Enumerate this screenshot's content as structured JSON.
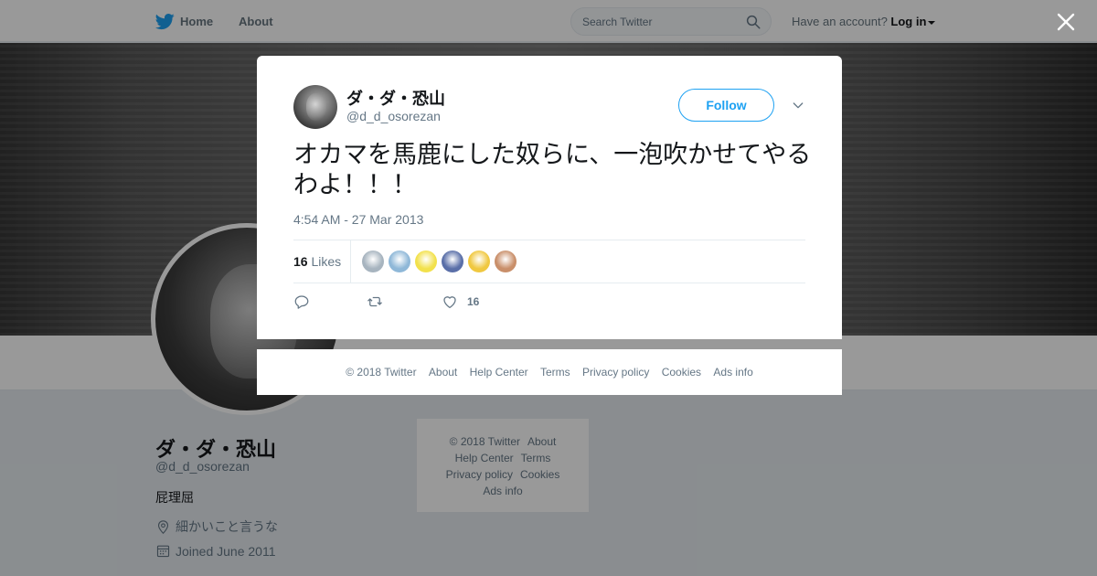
{
  "topbar": {
    "home_label": "Home",
    "about_label": "About",
    "search_placeholder": "Search Twitter",
    "account_prompt": "Have an account?",
    "login_label": "Log in"
  },
  "profile": {
    "name": "ダ・ダ・恐山",
    "handle": "@d_d_osorezan",
    "bio": "屁理屈",
    "location": "細かいこと言うな",
    "joined": "Joined June 2011"
  },
  "side_footer": {
    "links": [
      "© 2018 Twitter",
      "About",
      "Help Center",
      "Terms",
      "Privacy policy",
      "Cookies",
      "Ads info"
    ]
  },
  "tweet": {
    "author_name": "ダ・ダ・恐山",
    "author_handle": "@d_d_osorezan",
    "follow_label": "Follow",
    "text": "オカマを馬鹿にした奴らに、一泡吹かせてやるわよ！！！",
    "timestamp": "4:54 AM - 27 Mar 2013",
    "likes_count": "16",
    "likes_label": "Likes",
    "like_action_count": "16",
    "liker_colors": [
      "#a7b4bf",
      "#8fb8d8",
      "#f2e14c",
      "#5a6fa8",
      "#f0c840",
      "#c98f6a"
    ]
  },
  "modal_footer": {
    "links": [
      "© 2018 Twitter",
      "About",
      "Help Center",
      "Terms",
      "Privacy policy",
      "Cookies",
      "Ads info"
    ]
  },
  "colors": {
    "brand": "#1da1f2",
    "text_secondary": "#657786",
    "overlay": "rgba(0,0,0,0.4)"
  }
}
